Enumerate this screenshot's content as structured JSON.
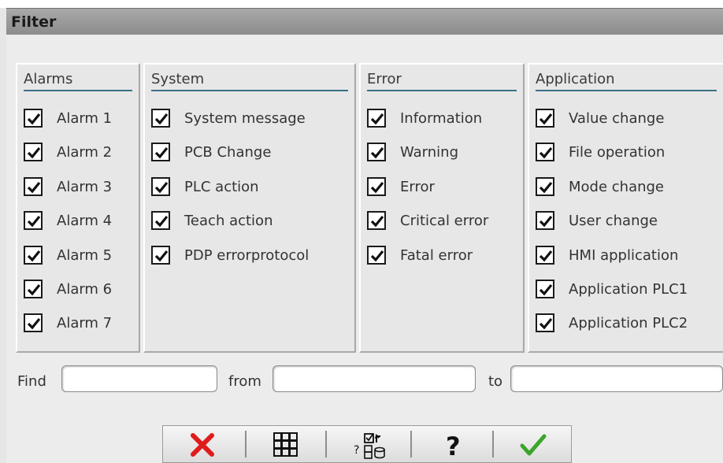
{
  "window": {
    "title": "Filter"
  },
  "panels": [
    {
      "title": "Alarms",
      "items": [
        "Alarm 1",
        "Alarm 2",
        "Alarm 3",
        "Alarm 4",
        "Alarm 5",
        "Alarm 6",
        "Alarm 7"
      ]
    },
    {
      "title": "System",
      "items": [
        "System message",
        "PCB Change",
        "PLC action",
        "Teach action",
        "PDP errorprotocol"
      ]
    },
    {
      "title": "Error",
      "items": [
        "Information",
        "Warning",
        "Error",
        "Critical error",
        "Fatal error"
      ]
    },
    {
      "title": "Application",
      "items": [
        "Value change",
        "File operation",
        "Mode change",
        "User change",
        "HMI application",
        "Application PLC1",
        "Application PLC2"
      ]
    }
  ],
  "find": {
    "find_label": "Find",
    "from_label": "from",
    "to_label": "to",
    "find_value": "",
    "from_value": "",
    "to_value": ""
  },
  "toolbar": {
    "buttons": [
      "cancel-icon",
      "grid-icon",
      "filter-config-icon",
      "help-icon",
      "ok-check-icon"
    ],
    "colors": {
      "cancel": "#e01b1b",
      "ok": "#3aa52a"
    }
  },
  "colors": {
    "accent_rule": "#3a6f86",
    "title_bar": "#9a9a9a"
  }
}
